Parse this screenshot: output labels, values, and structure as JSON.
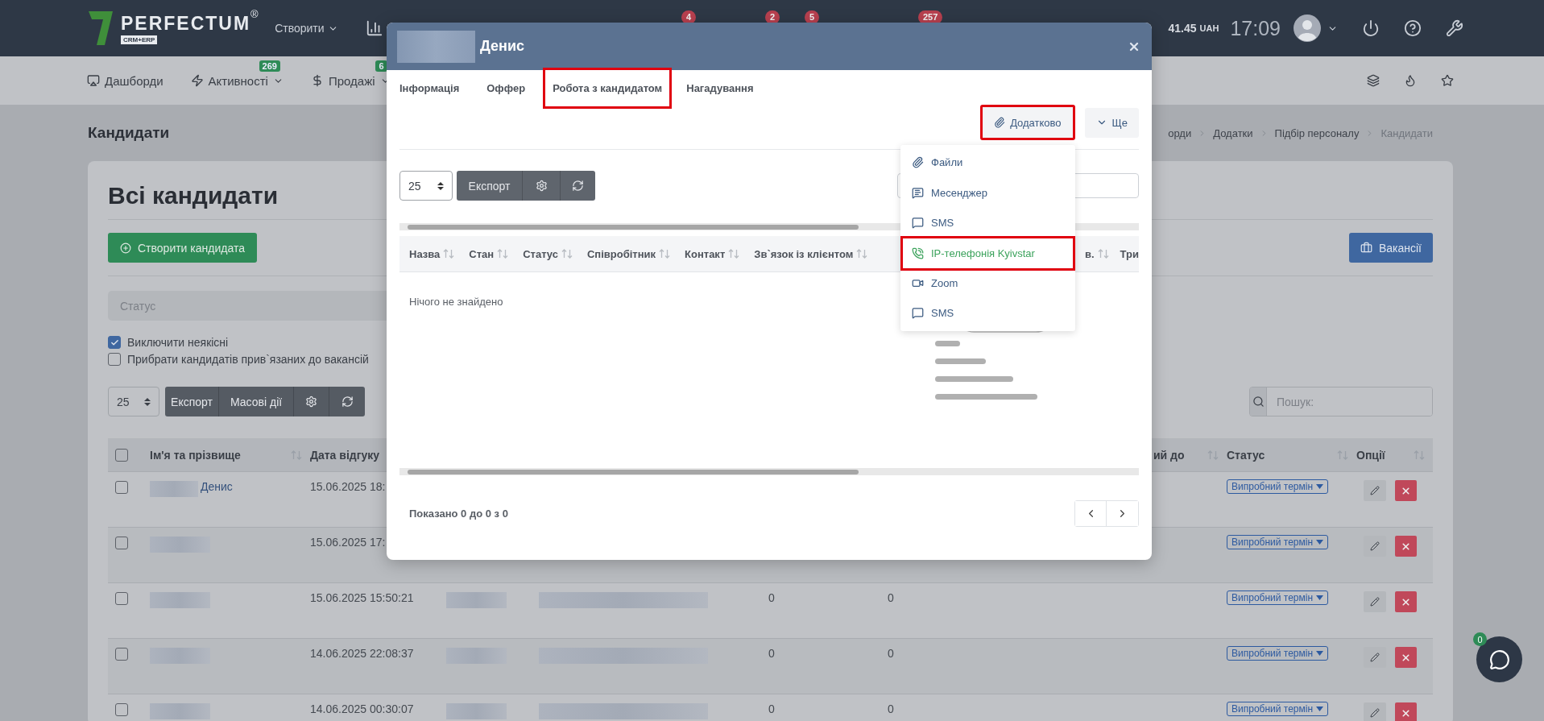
{
  "topbar": {
    "logo": "PERFECTUM",
    "logo_mark": "®",
    "logo_sub": "CRM+ERP",
    "create_menu": "Створити",
    "badges": [
      "4",
      "2",
      "5",
      "257"
    ],
    "balance": "41.45",
    "currency": "UAH",
    "time": "17:09"
  },
  "nav": [
    {
      "label": "Дашборди"
    },
    {
      "label": "Активності",
      "badge": "269"
    },
    {
      "label": "Продажі",
      "badge": "6"
    }
  ],
  "page_title": "Кандидати",
  "breadcrumbs": [
    "орди",
    "Додатки",
    "Підбір персоналу",
    "Кандидати"
  ],
  "card": {
    "title": "Всі кандидати",
    "create_button": "Створити кандидата",
    "vacancies_button": "Вакансії",
    "status_placeholder": "Статус",
    "filters": [
      {
        "label": "Виключити неякісні",
        "checked": true
      },
      {
        "label": "Прибрати кандидатів прив`язаних до вакансій",
        "checked": false
      }
    ],
    "page_size": "25",
    "toolbar": [
      "Експорт",
      "Масові дії"
    ],
    "search_placeholder": "Пошук:",
    "select_all_checked": false,
    "columns": [
      "Ім'я та прізвище",
      "Дата відгуку",
      "ий до",
      "Статус",
      "Опції"
    ],
    "rows": [
      {
        "checked": false,
        "name": "Денис",
        "date": "15.06.2025 18:",
        "values": [],
        "status": "Випробний термін"
      },
      {
        "checked": false,
        "date": "15.06.2025 17:",
        "values": [],
        "status": "Випробний термін"
      },
      {
        "checked": false,
        "date": "15.06.2025 15:50:21",
        "values": [
          "0",
          "0"
        ],
        "status": "Випробний термін"
      },
      {
        "checked": false,
        "date": "14.06.2025 22:08:37",
        "values": [
          "0",
          "0"
        ],
        "status": "Випробний термін"
      },
      {
        "checked": false,
        "date": "14.06.2025 00:30:07",
        "values": [
          "0",
          "0"
        ],
        "status": "Випробний термін"
      }
    ]
  },
  "modal": {
    "title": "Денис",
    "tabs": [
      {
        "label": "Інформація",
        "highlighted": false
      },
      {
        "label": "Оффер",
        "highlighted": false
      },
      {
        "label": "Робота з кандидатом",
        "highlighted": true
      },
      {
        "label": "Нагадування",
        "highlighted": false
      }
    ],
    "actions": [
      {
        "label": "Додатково",
        "kind": "attach",
        "highlighted": true
      },
      {
        "label": "Ще",
        "kind": "more",
        "highlighted": false
      }
    ],
    "page_size": "25",
    "export": "Експорт",
    "columns": [
      "Назва",
      "Стан",
      "Статус",
      "Співробітник",
      "Контакт",
      "Зв`язок із клієнтом"
    ],
    "columns_tail": [
      "в.",
      "Три"
    ],
    "empty": "Нічого не знайдено",
    "summary": "Показано 0 до 0 з 0",
    "menu": [
      {
        "label": "Файли",
        "kind": "files",
        "selected": false,
        "highlighted": false
      },
      {
        "label": "Месенджер",
        "kind": "messenger",
        "selected": false,
        "highlighted": false
      },
      {
        "label": "SMS",
        "kind": "sms",
        "selected": false,
        "highlighted": false
      },
      {
        "label": "IP-телефонія Kyivstar",
        "kind": "phone",
        "selected": true,
        "highlighted": true
      },
      {
        "label": "Zoom",
        "kind": "video",
        "selected": false,
        "highlighted": false
      },
      {
        "label": "SMS",
        "kind": "sms",
        "selected": false,
        "highlighted": false
      }
    ]
  },
  "chat": {
    "badge": "0"
  }
}
